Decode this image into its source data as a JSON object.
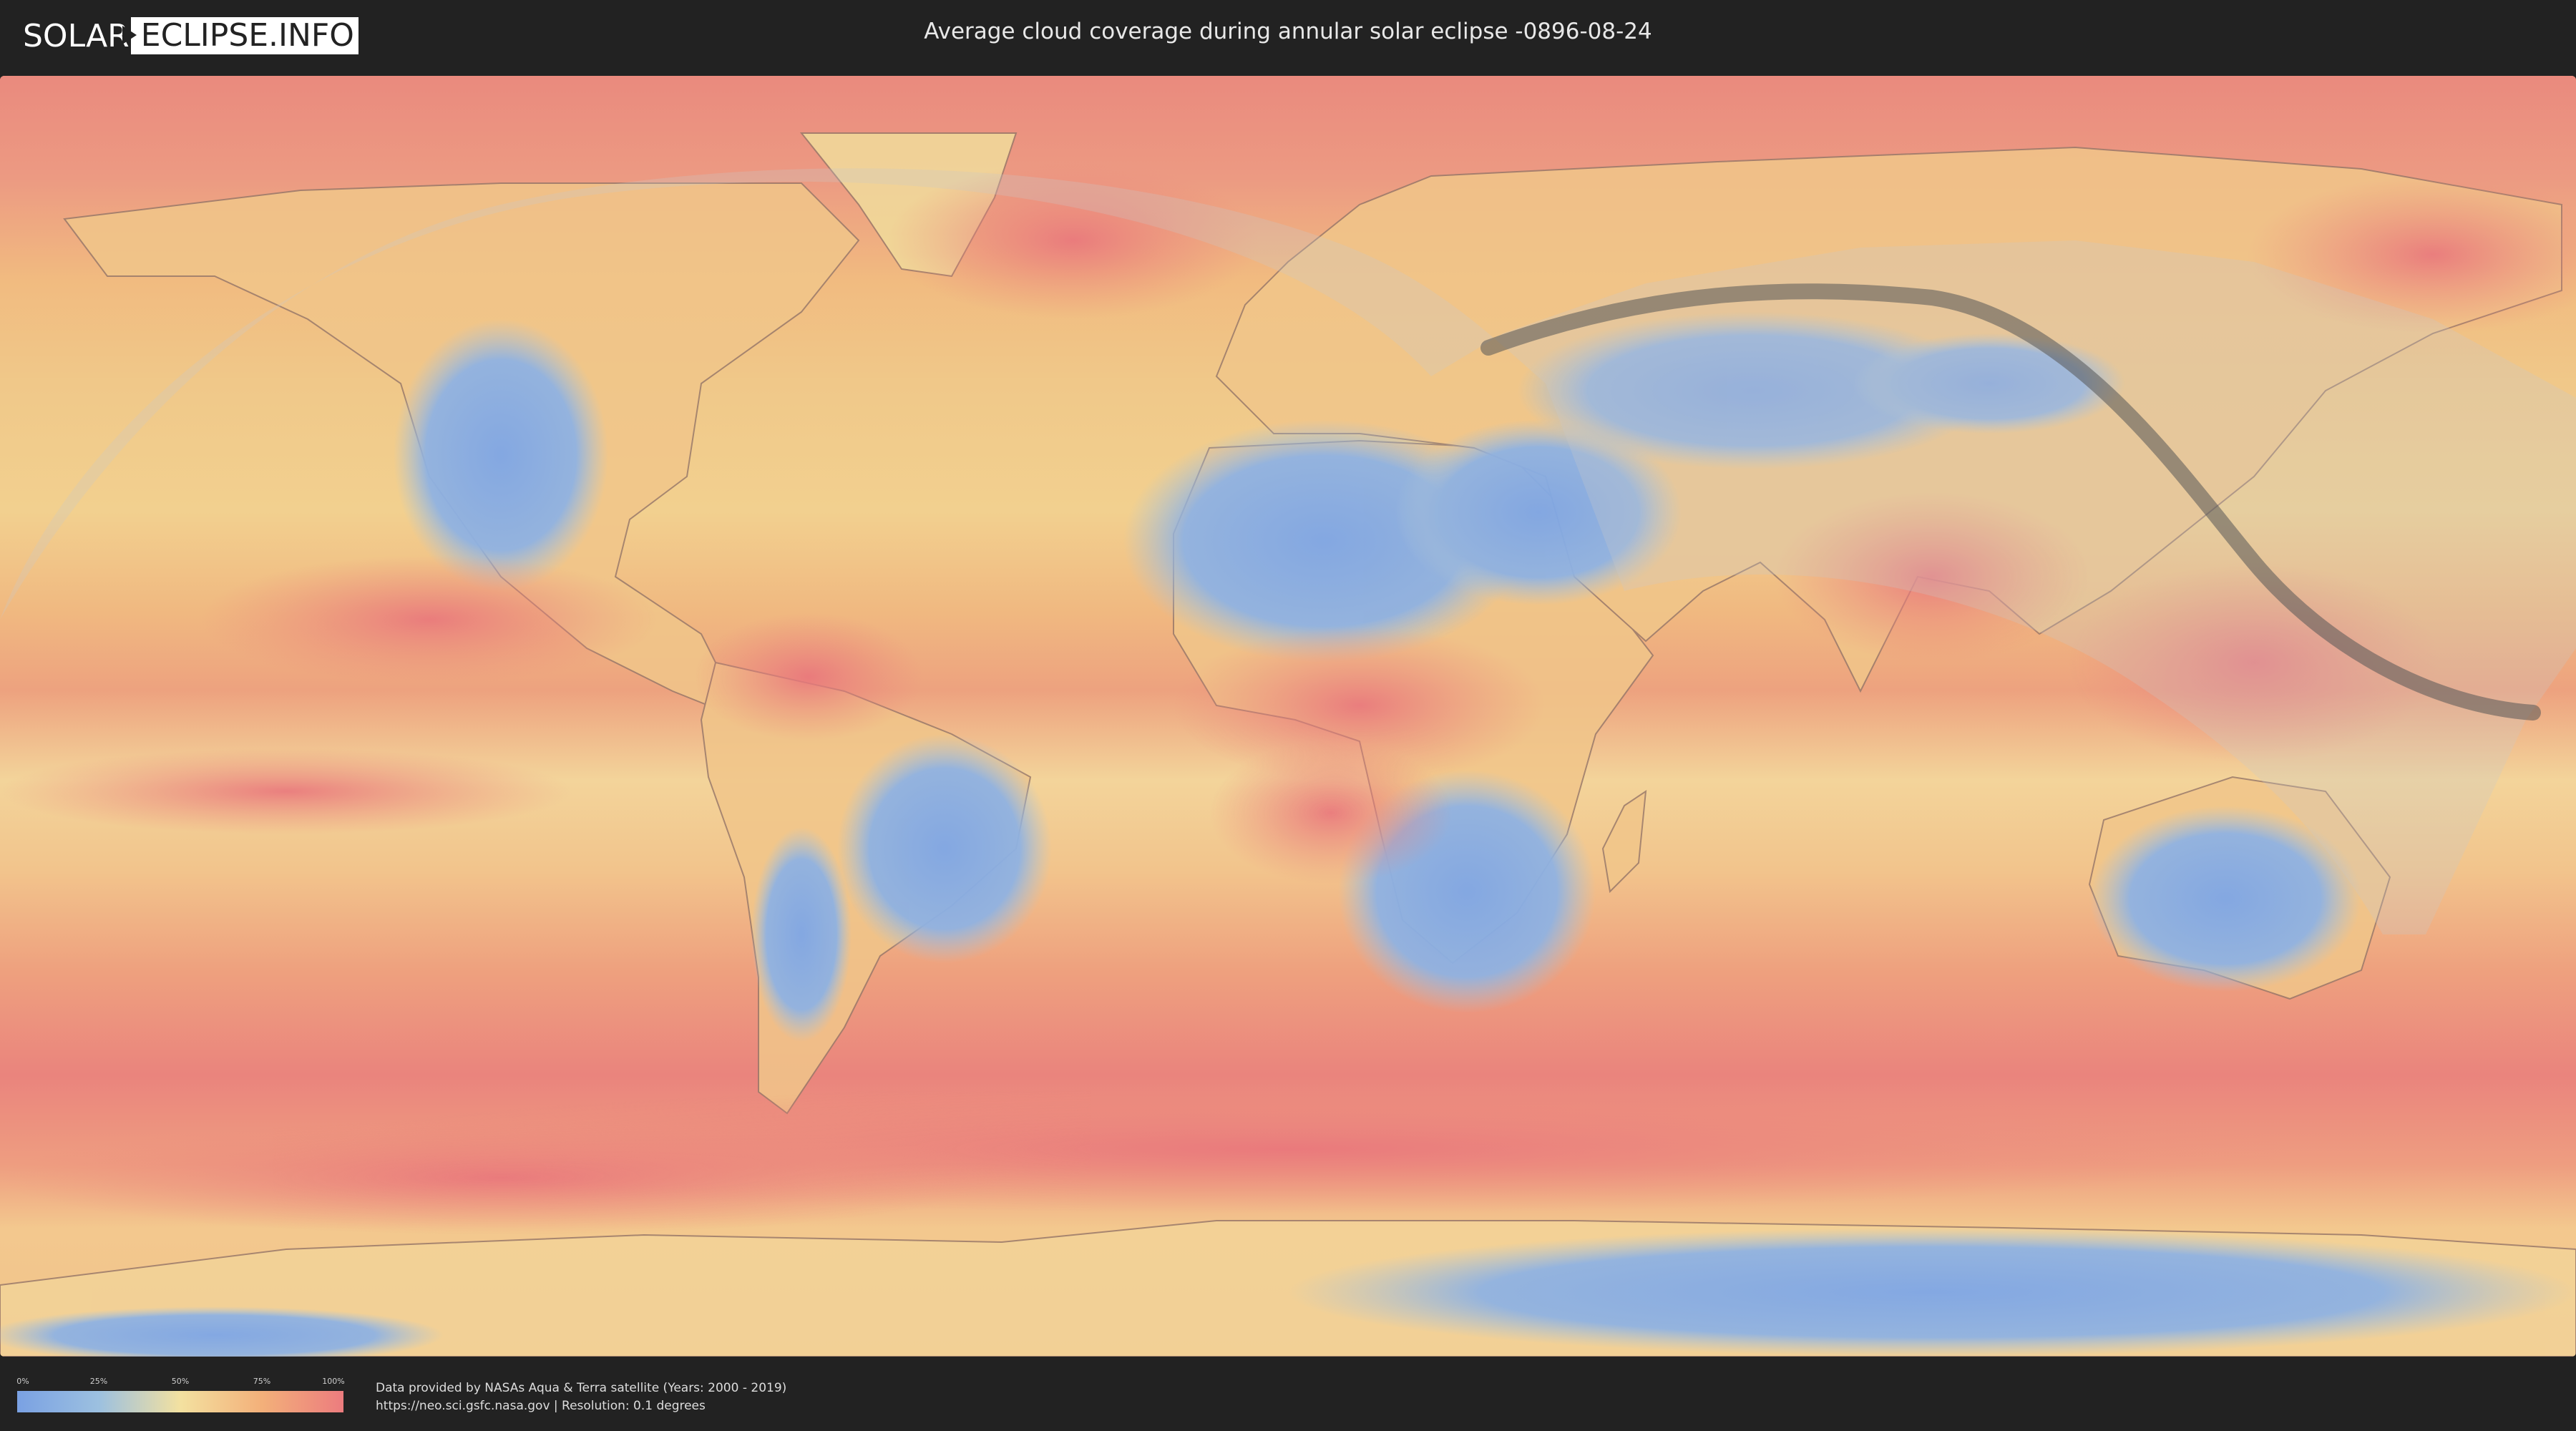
{
  "header": {
    "logo_left": "SOLAR",
    "logo_right": "ECLIPSE.INFO",
    "title": "Average cloud coverage during annular solar eclipse -0896-08-24"
  },
  "map": {
    "eclipse_path_color": "#555555",
    "visibility_overlay_color": "#c8c8c8"
  },
  "legend": {
    "ticks": [
      "0%",
      "25%",
      "50%",
      "75%",
      "100%"
    ],
    "colors": [
      "#7aa1e3",
      "#9cc0e0",
      "#f3e1a0",
      "#f3b07a",
      "#ec7c7e"
    ]
  },
  "footer": {
    "credit_line1": "Data provided by NASAs Aqua & Terra satellite (Years: 2000 - 2019)",
    "credit_line2": "https://neo.sci.gsfc.nasa.gov | Resolution: 0.1 degrees"
  }
}
